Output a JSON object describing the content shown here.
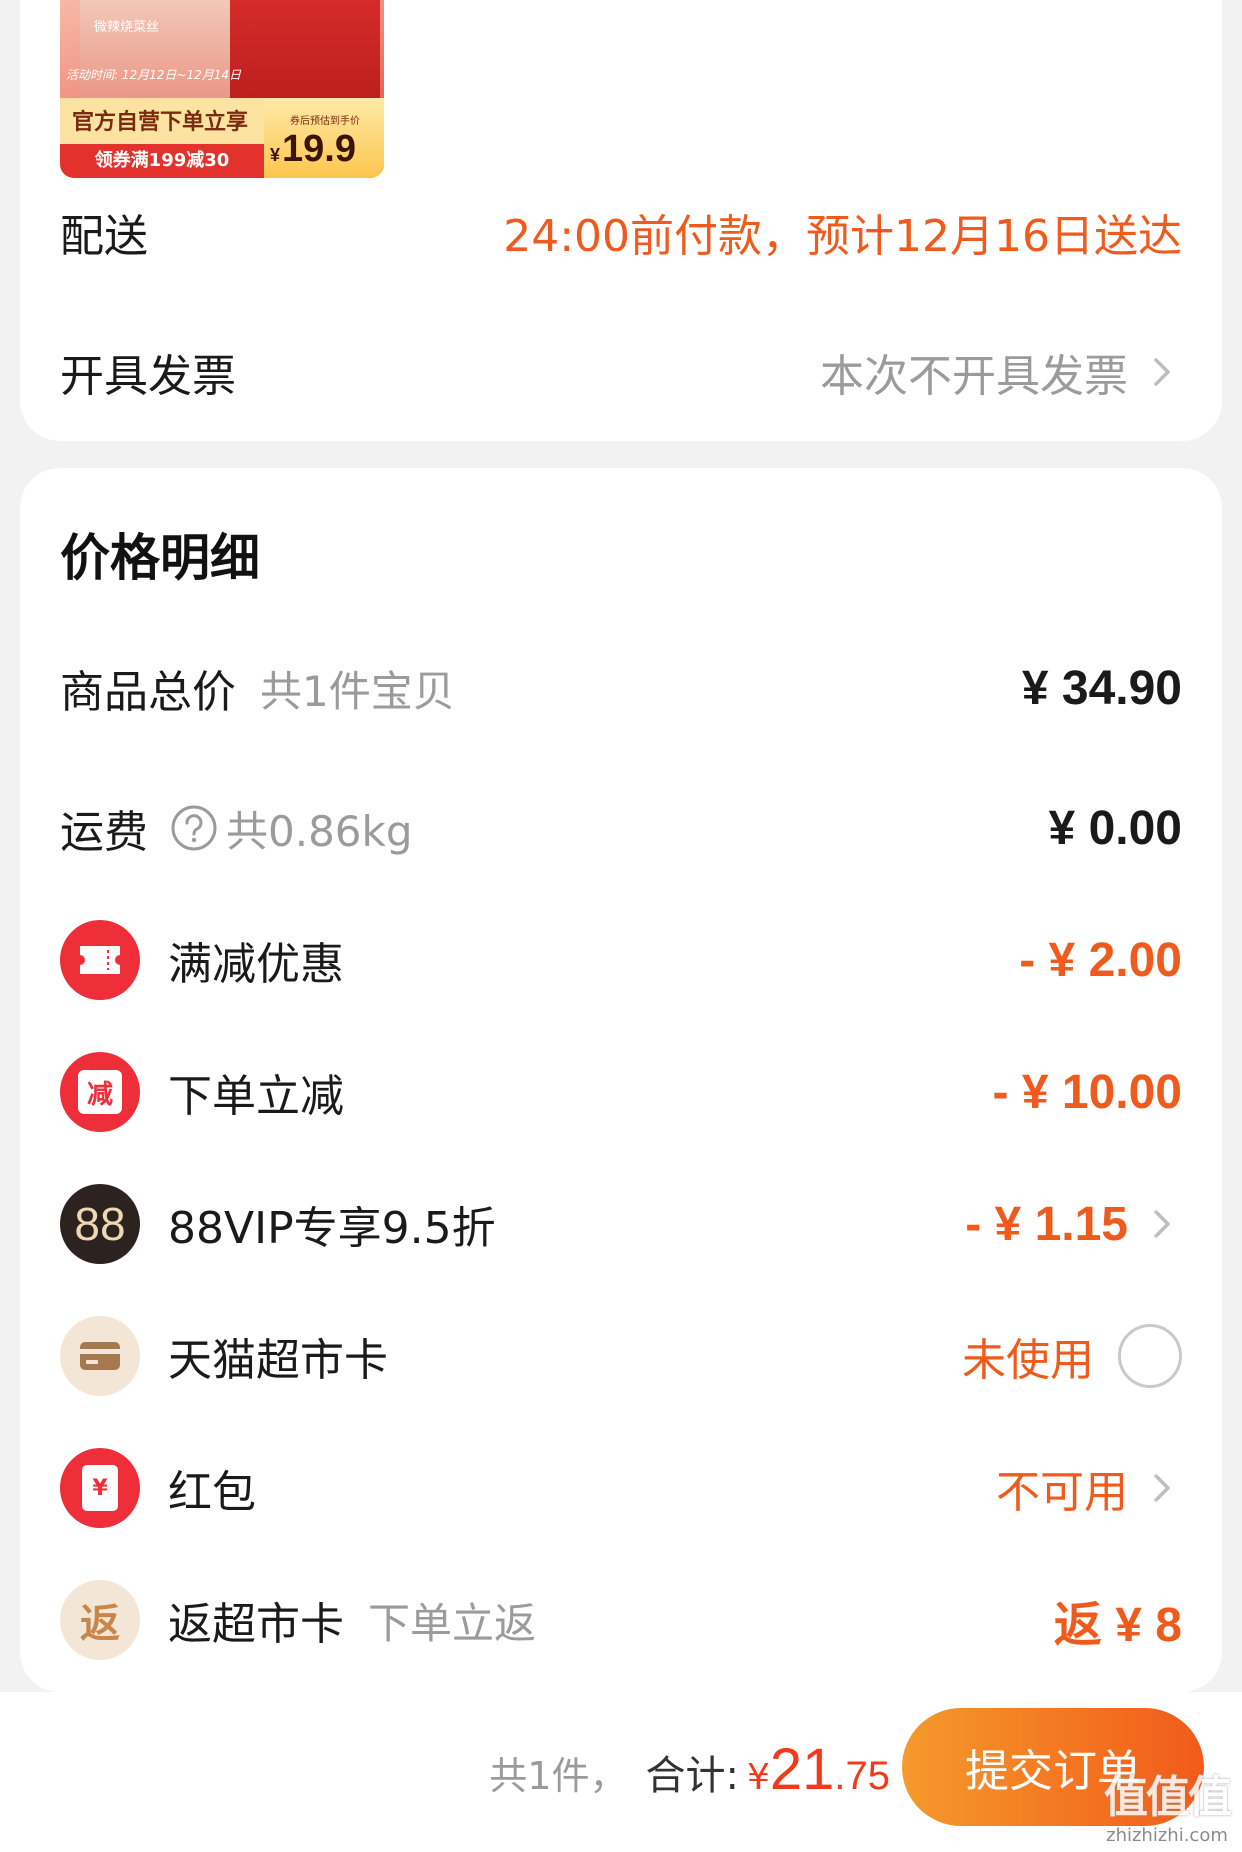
{
  "product": {
    "bag_text": "微辣烧菜丝",
    "activity_time": "活动时间: 12月12日~12月14日",
    "promo_line1": "官方自营下单立享",
    "promo_line2": "领券满199减30",
    "price_subtitle": "券后预估到手价",
    "price_symbol": "¥",
    "price": "19.9"
  },
  "delivery": {
    "label": "配送",
    "value": "24:00前付款，预计12月16日送达"
  },
  "invoice": {
    "label": "开具发票",
    "value": "本次不开具发票"
  },
  "price_detail": {
    "title": "价格明细",
    "goods_total": {
      "label": "商品总价",
      "sub": "共1件宝贝",
      "value": "¥ 34.90"
    },
    "shipping": {
      "label": "运费",
      "sub": "共0.86kg",
      "value": "¥ 0.00"
    },
    "full_reduction": {
      "label": "满减优惠",
      "value": "- ¥ 2.00"
    },
    "order_reduction": {
      "label": "下单立减",
      "icon_char": "减",
      "value": "- ¥ 10.00"
    },
    "vip": {
      "label": "88VIP专享9.5折",
      "icon_char": "88",
      "value": "- ¥ 1.15"
    },
    "market_card": {
      "label": "天猫超市卡",
      "value": "未使用"
    },
    "red_packet": {
      "label": "红包",
      "icon_char": "¥",
      "value": "不可用"
    },
    "rebate": {
      "label": "返超市卡",
      "icon_char": "返",
      "sub": "下单立返",
      "value": "返 ¥ 8"
    }
  },
  "bottom": {
    "count": "共1件，",
    "total_label": "合计:",
    "currency": "¥",
    "total_int": "21",
    "total_dec": ".75",
    "submit_label": "提交订单"
  },
  "watermark": {
    "big": "值值值",
    "small": "zhizhizhi.com"
  },
  "colors": {
    "accent": "#ef5b1c",
    "red": "#ee2f3a",
    "button_start": "#f59a2c",
    "button_end": "#f25a1a"
  }
}
